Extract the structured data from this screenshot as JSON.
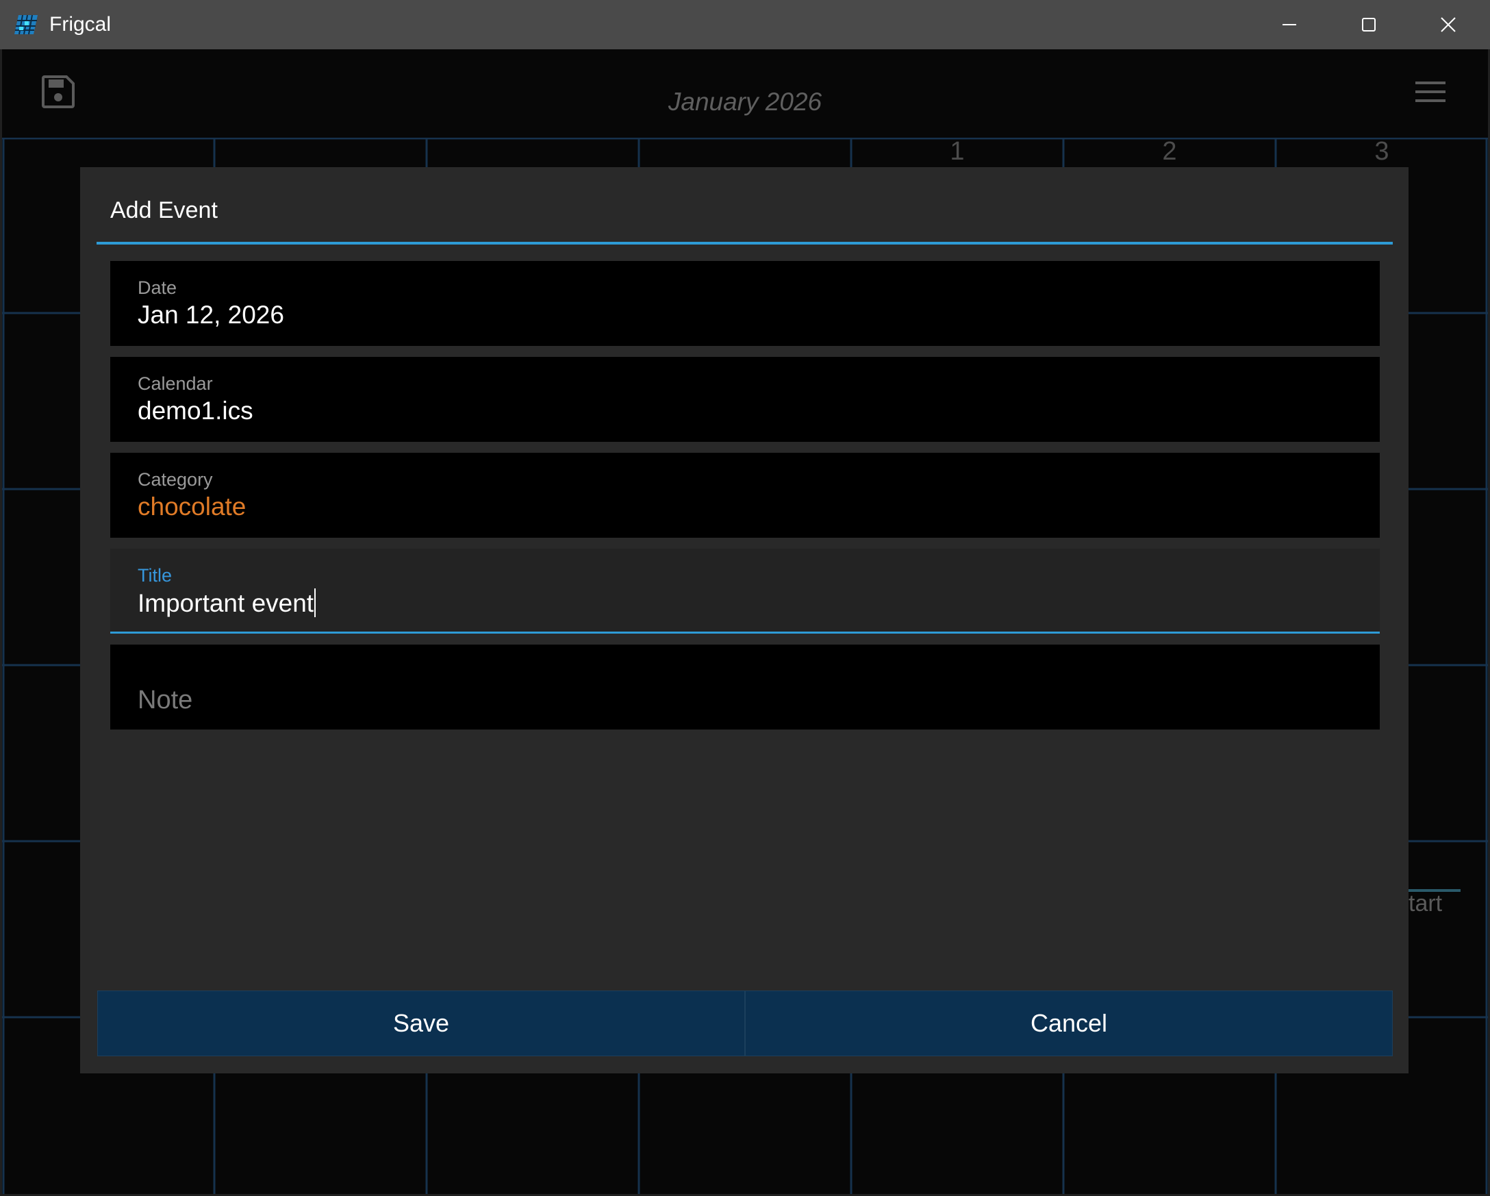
{
  "window": {
    "title": "Frigcal",
    "app_icon": "frigcal-grid-icon",
    "controls": {
      "minimize": "minimize-icon",
      "maximize": "maximize-icon",
      "close": "close-icon"
    }
  },
  "header": {
    "month_label": "January 2026",
    "save_icon": "floppy-disk-icon",
    "menu_icon": "hamburger-menu-icon"
  },
  "calendar": {
    "visible_day_numbers": [
      "1",
      "2",
      "3"
    ],
    "partial_text": "tart",
    "grid_color": "#16324d"
  },
  "dialog": {
    "title": "Add Event",
    "fields": {
      "date": {
        "label": "Date",
        "value": "Jan 12, 2026"
      },
      "calendar": {
        "label": "Calendar",
        "value": "demo1.ics"
      },
      "category": {
        "label": "Category",
        "value": "chocolate",
        "color": "#e07b27"
      },
      "title": {
        "label": "Title",
        "value": "Important event"
      },
      "note": {
        "placeholder": "Note",
        "value": ""
      }
    },
    "buttons": {
      "save": "Save",
      "cancel": "Cancel"
    },
    "accent_color": "#2e9bd6"
  }
}
